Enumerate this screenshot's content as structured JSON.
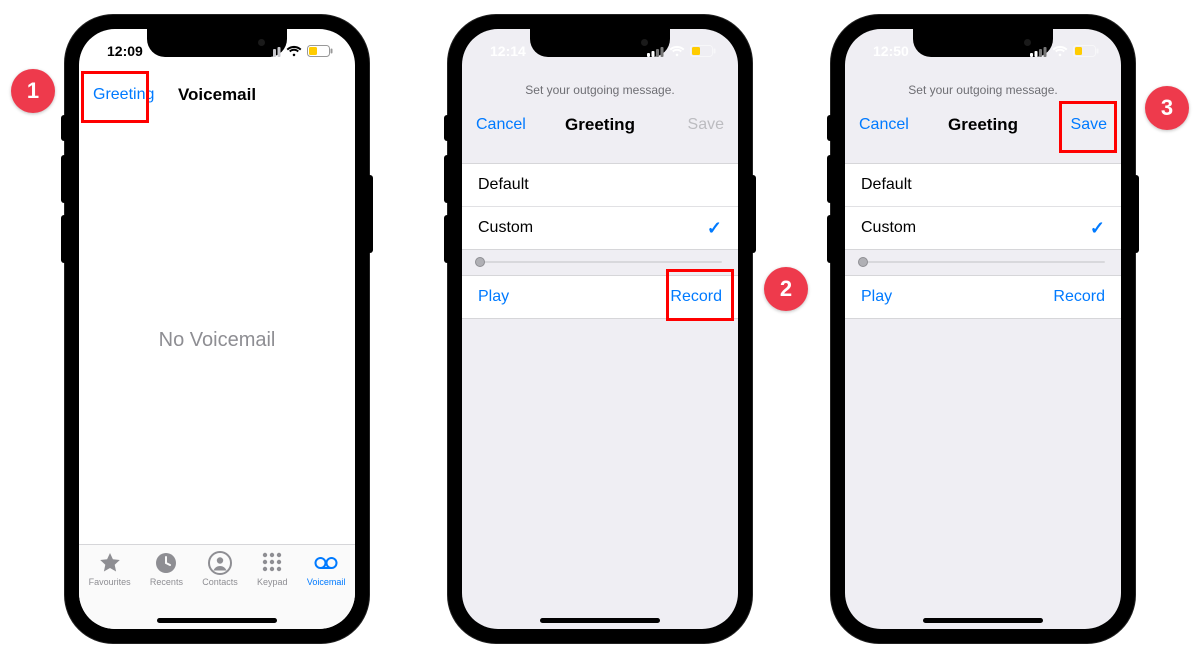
{
  "phones": {
    "p1": {
      "status_time": "12:09",
      "nav_left": "Greeting",
      "nav_title": "Voicemail",
      "empty_text": "No Voicemail",
      "tabs": {
        "favourites": "Favourites",
        "recents": "Recents",
        "contacts": "Contacts",
        "keypad": "Keypad",
        "voicemail": "Voicemail"
      }
    },
    "p2": {
      "status_time": "12:14",
      "instruction": "Set your outgoing message.",
      "nav_left": "Cancel",
      "nav_title": "Greeting",
      "nav_right": "Save",
      "option_default": "Default",
      "option_custom": "Custom",
      "play": "Play",
      "record": "Record"
    },
    "p3": {
      "status_time": "12:50",
      "instruction": "Set your outgoing message.",
      "nav_left": "Cancel",
      "nav_title": "Greeting",
      "nav_right": "Save",
      "option_default": "Default",
      "option_custom": "Custom",
      "play": "Play",
      "record": "Record"
    }
  },
  "annotations": {
    "a1": "1",
    "a2": "2",
    "a3": "3"
  }
}
